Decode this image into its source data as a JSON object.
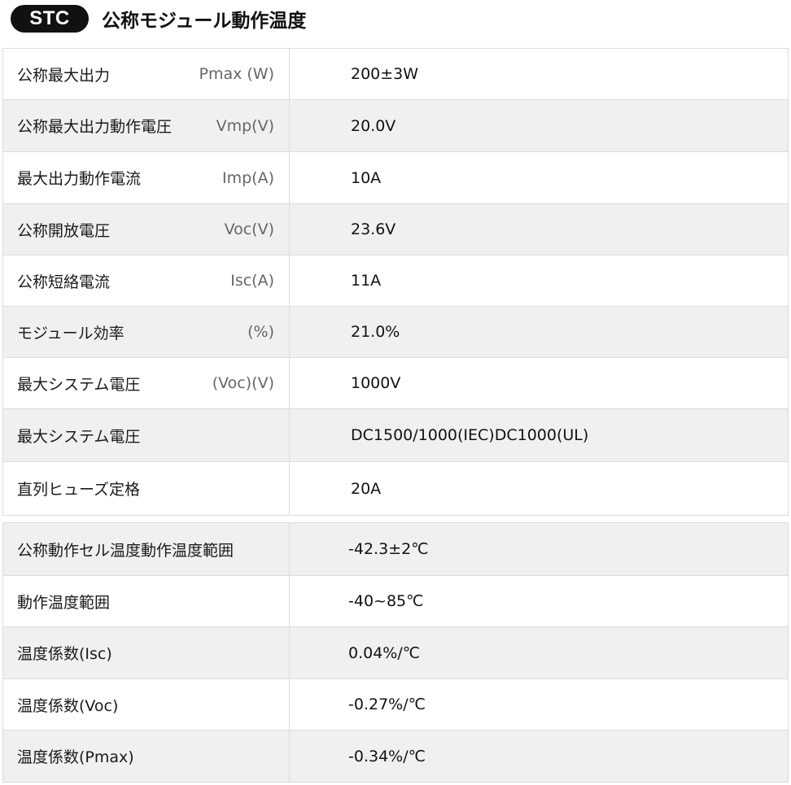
{
  "header": {
    "badge": "STC",
    "title": "公称モジュール動作温度"
  },
  "table1": {
    "rows": [
      {
        "name": "公称最大出力",
        "unit": "Pmax (W)",
        "value": "200±3W"
      },
      {
        "name": "公称最大出力動作電圧",
        "unit": "Vmp(V)",
        "value": "20.0V"
      },
      {
        "name": "最大出力動作電流",
        "unit": "Imp(A)",
        "value": "10A"
      },
      {
        "name": "公称開放電圧",
        "unit": "Voc(V)",
        "value": "23.6V"
      },
      {
        "name": "公称短絡電流",
        "unit": "Isc(A)",
        "value": "11A"
      },
      {
        "name": "モジュール効率",
        "unit": "(%)",
        "value": "21.0%"
      },
      {
        "name": "最大システム電圧",
        "unit": "(Voc)(V)",
        "value": "1000V"
      },
      {
        "name": "最大システム電圧",
        "unit": "",
        "value": "DC1500/1000(IEC)DC1000(UL)"
      },
      {
        "name": "直列ヒューズ定格",
        "unit": "",
        "value": "20A"
      }
    ]
  },
  "table2": {
    "rows": [
      {
        "name": "公称動作セル温度動作温度範囲",
        "unit": "",
        "value": "-42.3±2℃"
      },
      {
        "name": "動作温度範囲",
        "unit": "",
        "value": "-40~85℃"
      },
      {
        "name": "温度係数(Isc)",
        "unit": "",
        "value": "0.04%/℃"
      },
      {
        "name": "温度係数(Voc)",
        "unit": "",
        "value": "-0.27%/℃"
      },
      {
        "name": "温度係数(Pmax)",
        "unit": "",
        "value": "-0.34%/℃"
      }
    ]
  }
}
